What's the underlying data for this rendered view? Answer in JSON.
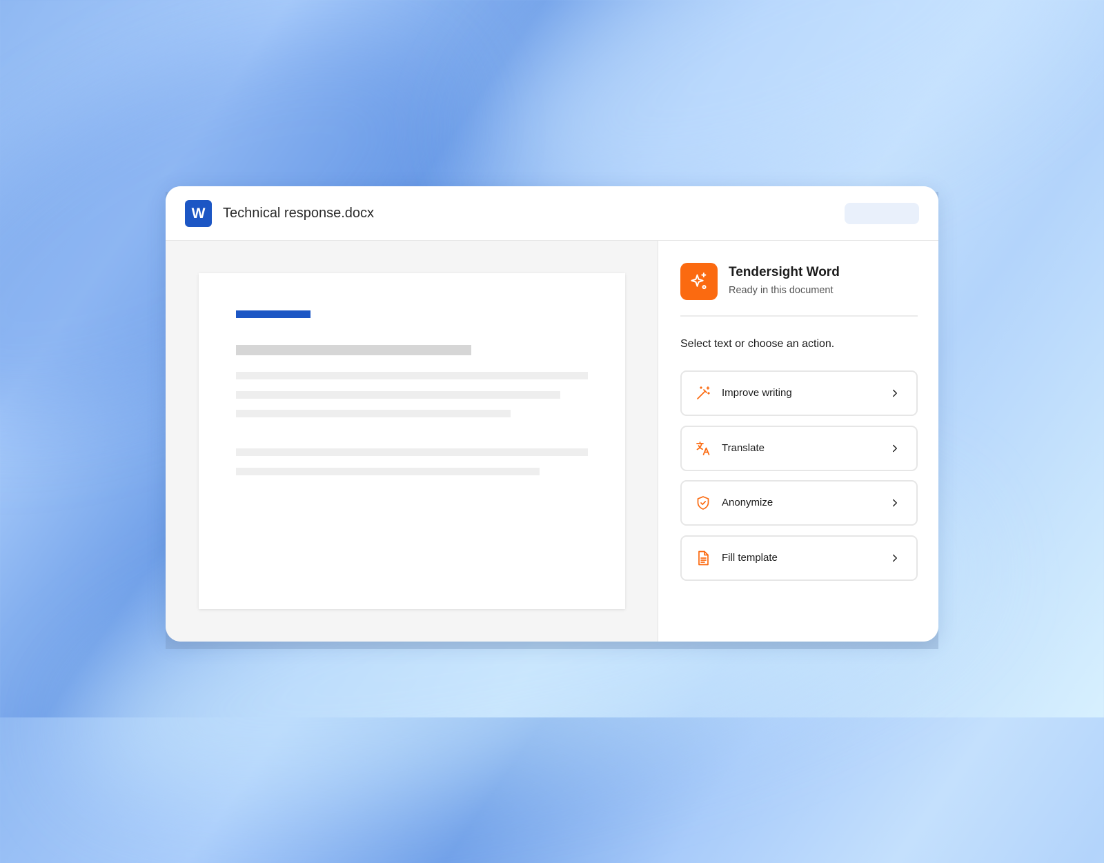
{
  "document": {
    "app_logo_letter": "W",
    "title": "Technical response.docx"
  },
  "assistant": {
    "name": "Tendersight Word",
    "status": "Ready in this document",
    "instruction": "Select text or choose an action.",
    "actions": [
      {
        "label": "Improve writing",
        "icon": "magic-wand-icon"
      },
      {
        "label": "Translate",
        "icon": "translate-icon"
      },
      {
        "label": "Anonymize",
        "icon": "shield-check-icon"
      },
      {
        "label": "Fill template",
        "icon": "document-icon"
      }
    ]
  },
  "colors": {
    "accent": "#fb6a10",
    "word_blue": "#1c56c4",
    "text": "#1b1b1b",
    "border": "#e6e6e6"
  }
}
